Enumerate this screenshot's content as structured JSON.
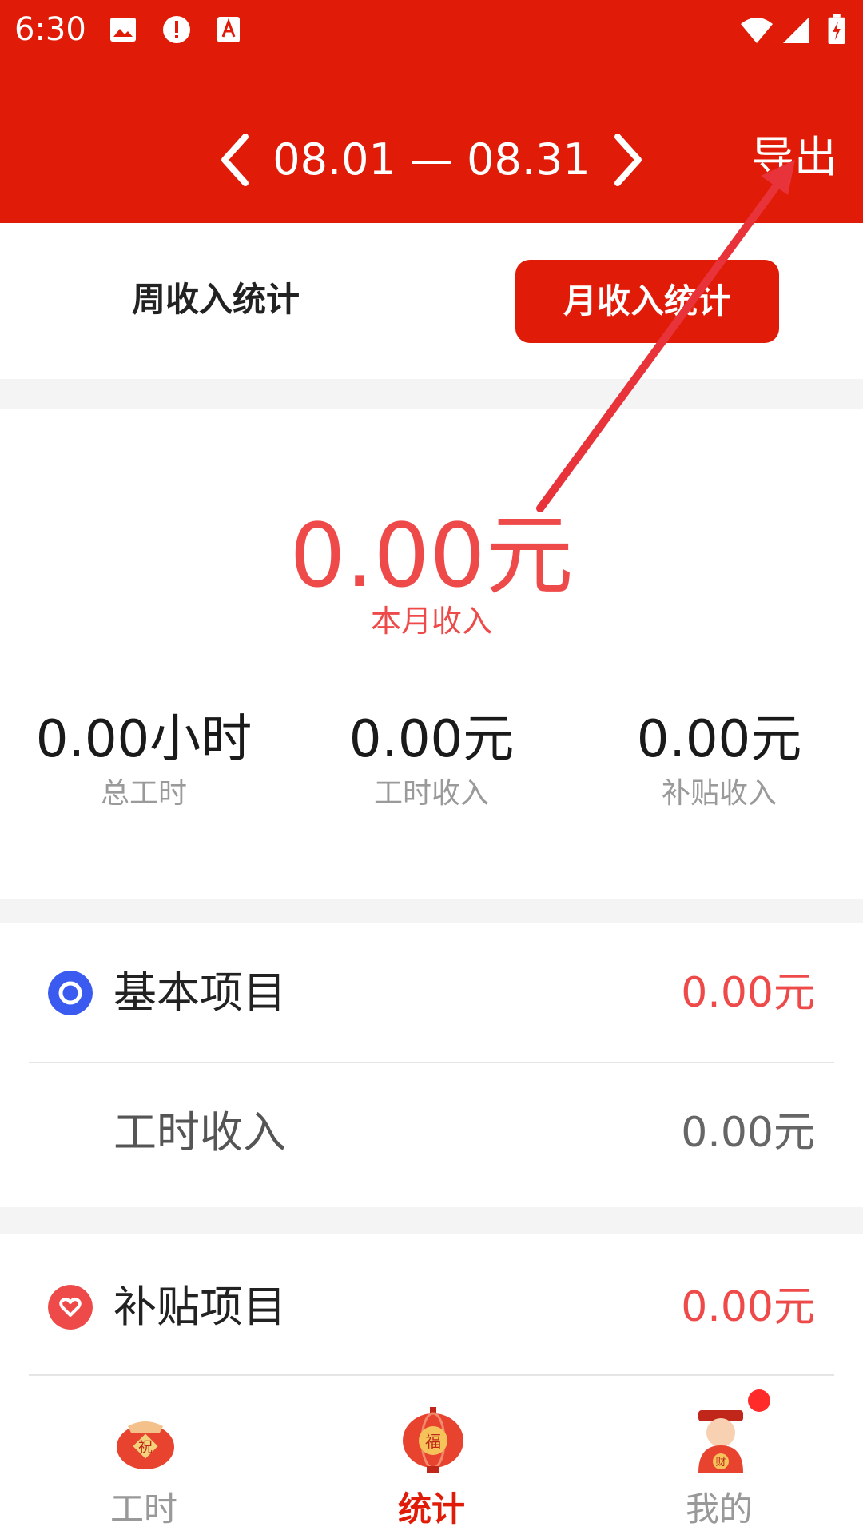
{
  "status_bar": {
    "time": "6:30"
  },
  "header": {
    "date_range": "08.01 — 08.31",
    "export_label": "导出"
  },
  "tabs": {
    "week": "周收入统计",
    "month": "月收入统计"
  },
  "summary": {
    "amount": "0.00元",
    "amount_label": "本月收入",
    "stats": [
      {
        "value": "0.00小时",
        "label": "总工时"
      },
      {
        "value": "0.00元",
        "label": "工时收入"
      },
      {
        "value": "0.00元",
        "label": "补贴收入"
      }
    ]
  },
  "basic": {
    "title": "基本项目",
    "value": "0.00元",
    "sub_title": "工时收入",
    "sub_value": "0.00元"
  },
  "subsidy": {
    "title": "补贴项目",
    "value": "0.00元"
  },
  "bottom_nav": {
    "items": [
      {
        "label": "工时",
        "icon_text": "祝"
      },
      {
        "label": "统计",
        "icon_text": "福"
      },
      {
        "label": "我的",
        "icon_text": "财"
      }
    ]
  },
  "colors": {
    "brand_red": "#e01c09",
    "amount_red": "#ef4a4a",
    "basic_blue": "#3b5bf0",
    "nav_active": "#e01c09",
    "nav_inactive": "#999999"
  }
}
